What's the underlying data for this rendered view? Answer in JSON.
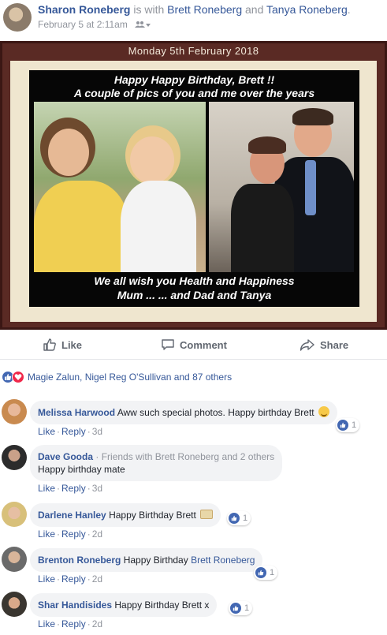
{
  "post": {
    "author": "Sharon Roneberg",
    "is_with_text": "is with",
    "tagged_1": "Brett Roneberg",
    "and_text": "and",
    "tagged_2": "Tanya Roneberg",
    "period": ".",
    "timestamp": "February 5 at 2:11am",
    "privacy_icon": "friends-icon"
  },
  "photo": {
    "date_banner": "Monday 5th February 2018",
    "top_line_1": "Happy Happy Birthday, Brett !!",
    "top_line_2": "A couple of pics of you and me over the years",
    "bottom_line_1": "We all wish you Health and Happiness",
    "bottom_line_2": "Mum ... ... and Dad and Tanya",
    "frame_color": "#5a2a24",
    "mat_color": "#efe6cf"
  },
  "actions": {
    "like": "Like",
    "comment": "Comment",
    "share": "Share"
  },
  "reactions": {
    "summary": "Magie Zalun, Nigel Reg O'Sullivan and 87 others",
    "icons": [
      "like-icon",
      "love-icon"
    ]
  },
  "comments": [
    {
      "name": "Melissa Harwood",
      "text": "Aww such special photos. Happy birthday Brett",
      "emoji": "smile-emoji",
      "like": "Like",
      "reply": "Reply",
      "time": "3d",
      "like_count": "1"
    },
    {
      "name": "Dave Gooda",
      "meta": "· Friends with Brett Roneberg and 2 others",
      "text": "Happy birthday mate",
      "like": "Like",
      "reply": "Reply",
      "time": "3d"
    },
    {
      "name": "Darlene Hanley",
      "text": "Happy Birthday Brett",
      "emoji": "cake-emoji",
      "like": "Like",
      "reply": "Reply",
      "time": "2d",
      "like_count": "1"
    },
    {
      "name": "Brenton Roneberg",
      "text": "Happy Birthday",
      "tag": "Brett Roneberg",
      "like": "Like",
      "reply": "Reply",
      "time": "2d",
      "like_count": "1"
    },
    {
      "name": "Shar Handisides",
      "text": "Happy Birthday Brett x",
      "like": "Like",
      "reply": "Reply",
      "time": "2d",
      "like_count": "1"
    }
  ],
  "colors": {
    "link": "#365899",
    "muted": "#90949c",
    "like_blue": "#4267b2",
    "love_red": "#f0284a",
    "bubble": "#f2f3f5"
  }
}
